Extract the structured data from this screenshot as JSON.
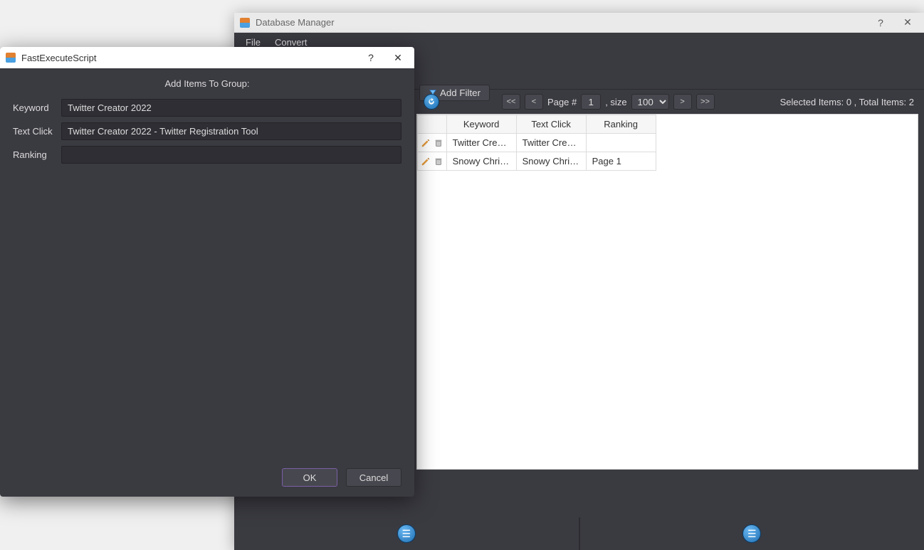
{
  "dbm": {
    "title": "Database Manager",
    "help": "?",
    "menu": {
      "file": "File",
      "convert": "Convert"
    },
    "add_filter_label": "Add Filter",
    "pager": {
      "first": "<<",
      "prev": "<",
      "page_label": "Page #",
      "page_value": "1",
      "size_label": ", size",
      "size_value": "100",
      "next": ">",
      "last": ">>"
    },
    "selected_label": "Selected Items:",
    "selected_count": "0",
    "total_label": ", Total Items:",
    "total_count": "2",
    "columns": {
      "keyword": "Keyword",
      "text_click": "Text Click",
      "ranking": "Ranking"
    },
    "rows": [
      {
        "keyword": "Twitter Creat...",
        "text_click": "Twitter Creat...",
        "ranking": ""
      },
      {
        "keyword": "Snowy Christ...",
        "text_click": "Snowy Christ...",
        "ranking": "Page 1"
      }
    ]
  },
  "dlg": {
    "title": "FastExecuteScript",
    "help": "?",
    "header": "Add Items To Group:",
    "fields": {
      "keyword_label": "Keyword",
      "keyword_value": "Twitter Creator 2022",
      "textclick_label": "Text Click",
      "textclick_value": "Twitter Creator 2022 - Twitter Registration Tool",
      "ranking_label": "Ranking",
      "ranking_value": ""
    },
    "ok_label": "OK",
    "cancel_label": "Cancel"
  }
}
